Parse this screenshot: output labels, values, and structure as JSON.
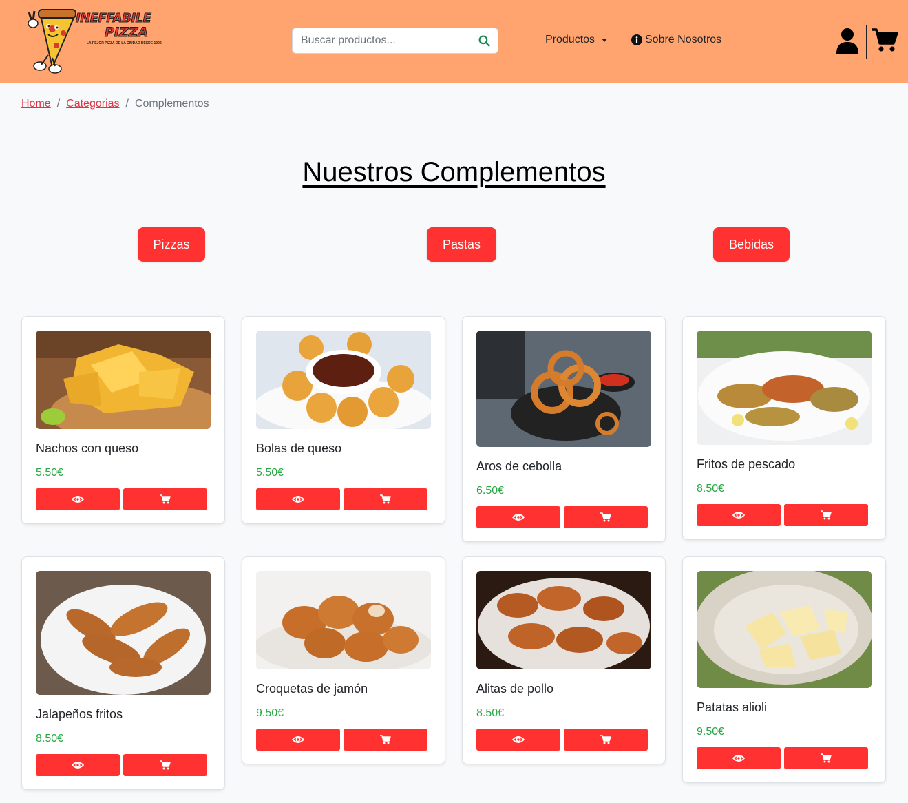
{
  "header": {
    "logo_text_line1": "INEFFABILE",
    "logo_text_line2": "PIZZA",
    "logo_tagline": "LA PEJOR PIZZA DE LA CIUDAD DESDE 1902",
    "search_placeholder": "Buscar productos...",
    "search_icon": "search-icon",
    "nav_productos": "Productos",
    "nav_sobre": "Sobre Nosotros",
    "user_icon": "user-icon",
    "cart_icon": "cart-icon",
    "colors": {
      "background": "#ffa46e",
      "accent": "#ff3131",
      "search_icon": "#198754"
    }
  },
  "breadcrumb": {
    "home": "Home",
    "categorias": "Categorias",
    "current": "Complementos"
  },
  "main": {
    "title": "Nuestros Complementos",
    "categories": [
      "Pizzas",
      "Pastas",
      "Bebidas"
    ],
    "products": [
      {
        "name": "Nachos con queso",
        "price": "5.50€"
      },
      {
        "name": "Bolas de queso",
        "price": "5.50€"
      },
      {
        "name": "Aros de cebolla",
        "price": "6.50€"
      },
      {
        "name": "Fritos de pescado",
        "price": "8.50€"
      },
      {
        "name": "Jalapeños fritos",
        "price": "8.50€"
      },
      {
        "name": "Croquetas de jamón",
        "price": "9.50€"
      },
      {
        "name": "Alitas de pollo",
        "price": "8.50€"
      },
      {
        "name": "Patatas alioli",
        "price": "9.50€"
      }
    ],
    "card_actions": {
      "view_icon": "eye-icon",
      "cart_icon": "cart-icon"
    },
    "price_color": "#28a745"
  }
}
